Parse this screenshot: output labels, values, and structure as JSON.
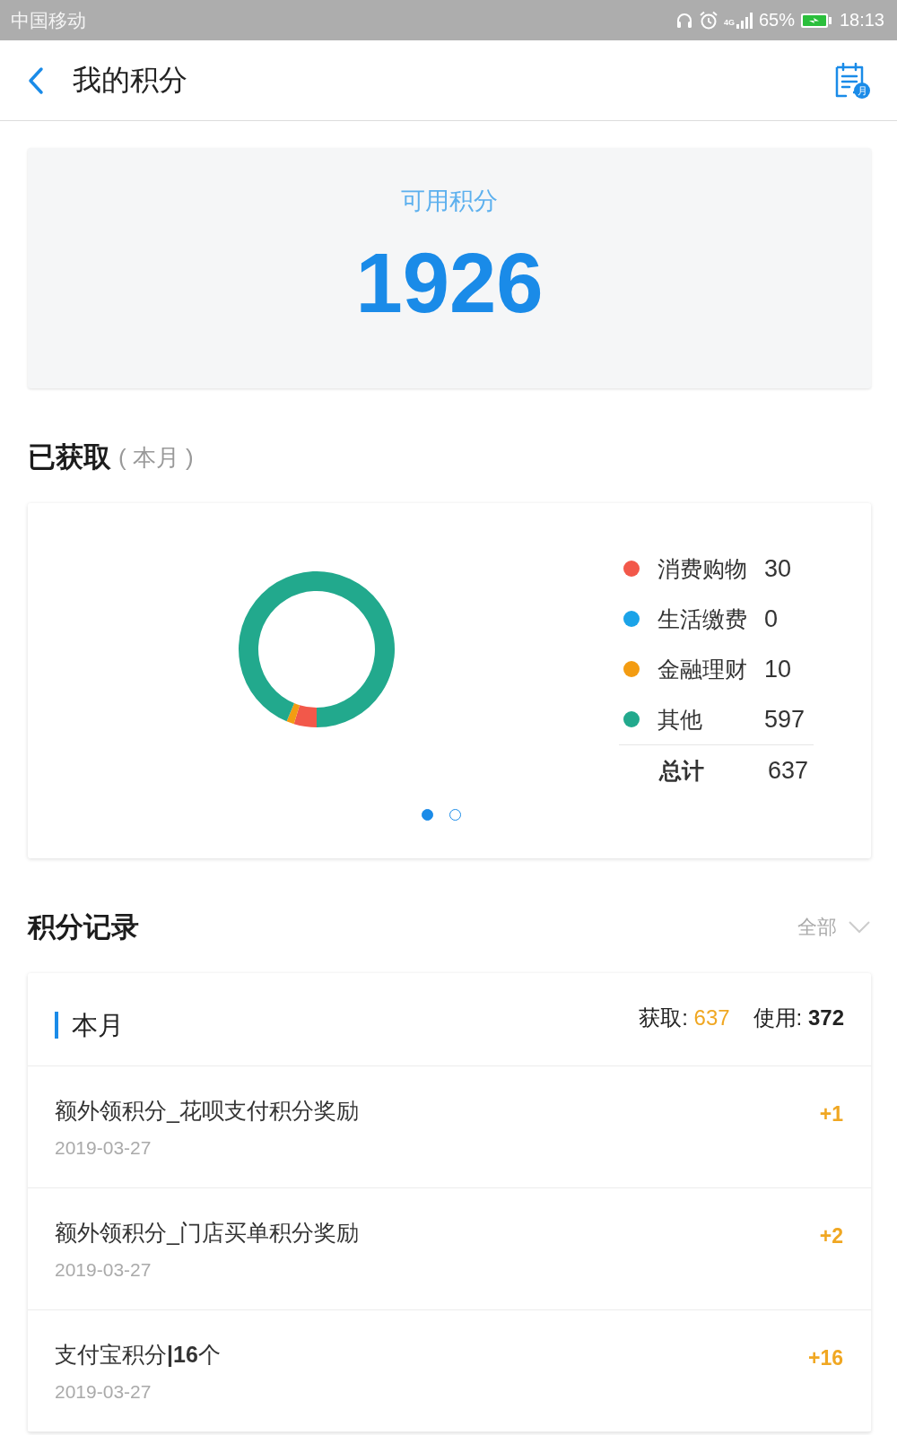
{
  "status_bar": {
    "carrier": "中国移动",
    "network": "4G",
    "battery": "65%",
    "time": "18:13"
  },
  "header": {
    "title": "我的积分",
    "action_badge": "月"
  },
  "balance_card": {
    "label": "可用积分",
    "value": "1926"
  },
  "earned_section": {
    "title": "已获取",
    "subtitle": "( 本月 )"
  },
  "earned_chart": {
    "chart_data": {
      "type": "donut",
      "categories": [
        "消费购物",
        "生活缴费",
        "金融理财",
        "其他"
      ],
      "values": [
        4.71,
        0,
        1.57,
        93.72
      ],
      "legend": "right"
    },
    "legend": [
      {
        "value": "30",
        "color": "#f2584a"
      },
      {
        "value": "0",
        "color": "#1ba3e8"
      },
      {
        "value": "10",
        "color": "#f39c12"
      },
      {
        "value": "597",
        "color": "#22a98d"
      }
    ],
    "total": {
      "label": "总计",
      "value": "637"
    },
    "pages": [
      {
        "selected": true
      },
      {
        "selected": false
      }
    ]
  },
  "records_section": {
    "title": "积分记录",
    "filter": "全部"
  },
  "records_card": {
    "period": "本月",
    "earned_label": "获取:",
    "earned": "637",
    "used_label": "使用:",
    "used": "372",
    "rows": [
      {
        "title": "额外领积分_花呗支付积分奖励",
        "date": "2019-03-27",
        "amount": "+1"
      },
      {
        "title": "额外领积分_门店买单积分奖励",
        "date": "2019-03-27",
        "amount": "+2"
      },
      {
        "title": "支付宝积分**|16**个",
        "date": "2019-03-27",
        "amount": "+16"
      }
    ]
  }
}
